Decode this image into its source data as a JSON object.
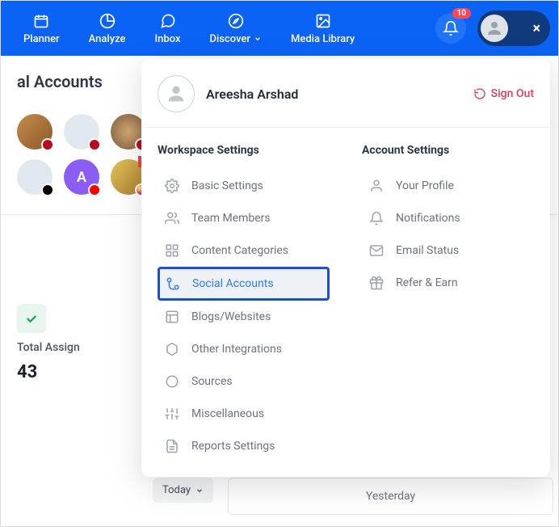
{
  "nav": {
    "planner": "Planner",
    "analyze": "Analyze",
    "inbox": "Inbox",
    "discover": "Discover",
    "media_library": "Media Library",
    "badge": "10"
  },
  "page": {
    "title": "al Accounts"
  },
  "avatar_letter": "A",
  "stats": {
    "label": "Total Assign",
    "value": "43"
  },
  "filter": {
    "today": "Today"
  },
  "panel": {
    "yesterday": "Yesterday"
  },
  "dropdown": {
    "user_name": "Areesha Arshad",
    "sign_out": "Sign Out",
    "workspace_header": "Workspace Settings",
    "account_header": "Account Settings",
    "workspace": {
      "basic": "Basic Settings",
      "team": "Team Members",
      "content": "Content Categories",
      "social": "Social Accounts",
      "blogs": "Blogs/Websites",
      "other": "Other Integrations",
      "sources": "Sources",
      "misc": "Miscellaneous",
      "reports": "Reports Settings"
    },
    "account": {
      "profile": "Your Profile",
      "notifications": "Notifications",
      "email": "Email Status",
      "refer": "Refer & Earn"
    }
  }
}
